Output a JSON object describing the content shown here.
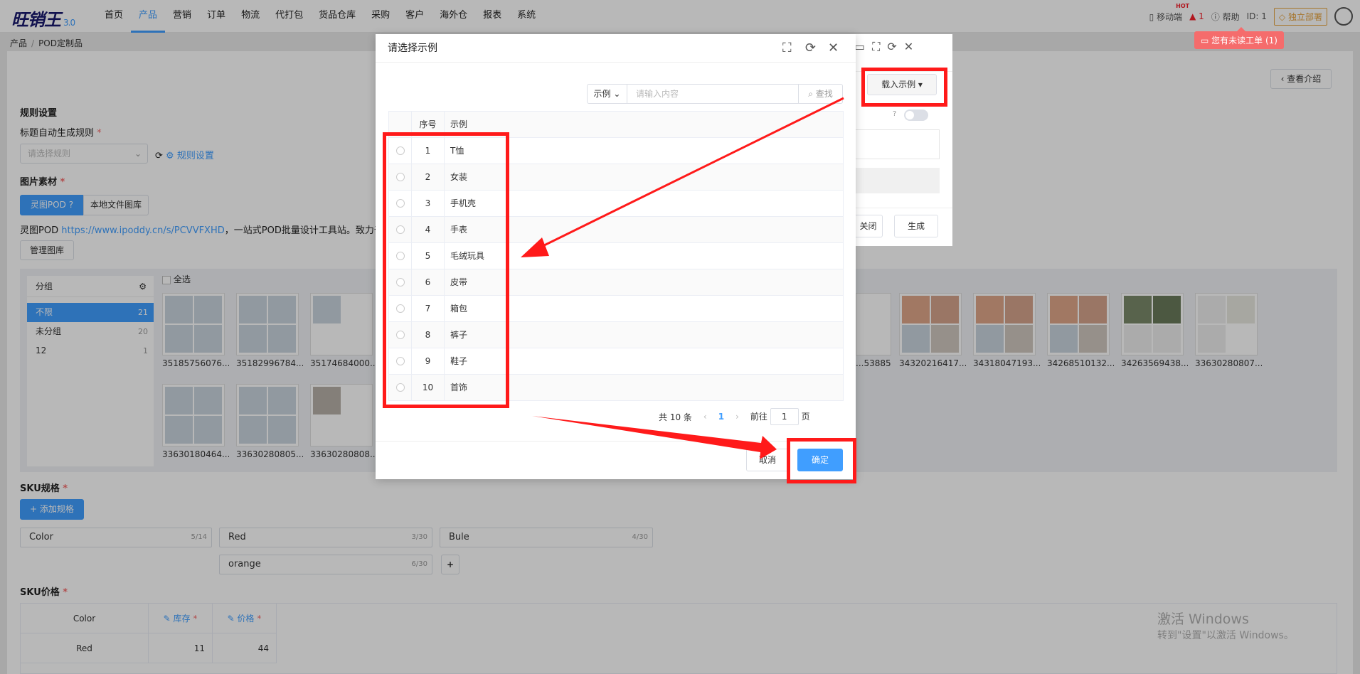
{
  "app": {
    "logo": "旺销王",
    "version": "3.0"
  },
  "nav": {
    "items": [
      "首页",
      "产品",
      "营销",
      "订单",
      "物流",
      "代打包",
      "货品仓库",
      "采购",
      "客户",
      "海外仓",
      "报表",
      "系统"
    ],
    "active_index": 1
  },
  "topright": {
    "mobile": "移动端",
    "hot_badge": "HOT",
    "alerts": "1",
    "help": "帮助",
    "id": "ID: 1",
    "deploy": "独立部署",
    "notice": "您有未读工单 (1)"
  },
  "breadcrumb": [
    "产品",
    "POD定制品"
  ],
  "page": {
    "view_intro": "查看介绍",
    "rules_title": "规则设置",
    "title_rule_label": "标题自动生成规则",
    "title_rule_placeholder": "请选择规则",
    "rule_settings_link": "规则设置",
    "image_material": "图片素材",
    "tab_lingtu": "灵图POD",
    "tab_local": "本地文件图库",
    "desc_prefix": "灵图POD",
    "desc_link": "https://www.ipoddy.cn/s/PCVVFXHD",
    "desc_suffix": "，一站式POD批量设计工具站。致力于通过",
    "manage_gallery": "管理图库",
    "group_title": "分组",
    "groups": [
      {
        "name": "不限",
        "count": "21"
      },
      {
        "name": "未分组",
        "count": "20"
      },
      {
        "name": "12",
        "count": "1"
      }
    ],
    "select_all": "全选",
    "row1_left": [
      "35185756076...",
      "35182996784...",
      "35174684000..."
    ],
    "row1_right": [
      "...53885...",
      "34320216417...",
      "34318047193...",
      "34268510132...",
      "34263569438...",
      "33630280807..."
    ],
    "row2": [
      "33630180464...",
      "33630280805...",
      "33630280808..."
    ],
    "sku_spec": "SKU规格",
    "add_spec": "添加规格",
    "sku_values": [
      {
        "name": "Color",
        "count": "5/14"
      },
      {
        "name": "Red",
        "count": "3/30"
      },
      {
        "name": "Bule",
        "count": "4/30"
      },
      {
        "name": "orange",
        "count": "6/30"
      }
    ],
    "sku_price": "SKU价格",
    "price_headers": [
      "Color",
      "库存",
      "价格"
    ],
    "price_row": [
      "Red",
      "11",
      "44"
    ]
  },
  "bg_window": {
    "load_example": "载入示例",
    "close": "关闭",
    "generate": "生成"
  },
  "dialog": {
    "title": "请选择示例",
    "search_type": "示例",
    "search_placeholder": "请输入内容",
    "search_button": "查找",
    "col_no": "序号",
    "col_name": "示例",
    "rows": [
      {
        "no": "1",
        "name": "T恤"
      },
      {
        "no": "2",
        "name": "女装"
      },
      {
        "no": "3",
        "name": "手机壳"
      },
      {
        "no": "4",
        "name": "手表"
      },
      {
        "no": "5",
        "name": "毛绒玩具"
      },
      {
        "no": "6",
        "name": "皮带"
      },
      {
        "no": "7",
        "name": "箱包"
      },
      {
        "no": "8",
        "name": "裤子"
      },
      {
        "no": "9",
        "name": "鞋子"
      },
      {
        "no": "10",
        "name": "首饰"
      }
    ],
    "total": "共 10 条",
    "current_page": "1",
    "goto_prefix": "前往",
    "goto_value": "1",
    "goto_suffix": "页",
    "cancel": "取消",
    "confirm": "确定"
  },
  "watermark": {
    "line1": "激活 Windows",
    "line2": "转到\"设置\"以激活 Windows。"
  },
  "colors": {
    "accent": "#409eff",
    "annotation": "#ff1a1a",
    "notice": "#f56c6c"
  }
}
